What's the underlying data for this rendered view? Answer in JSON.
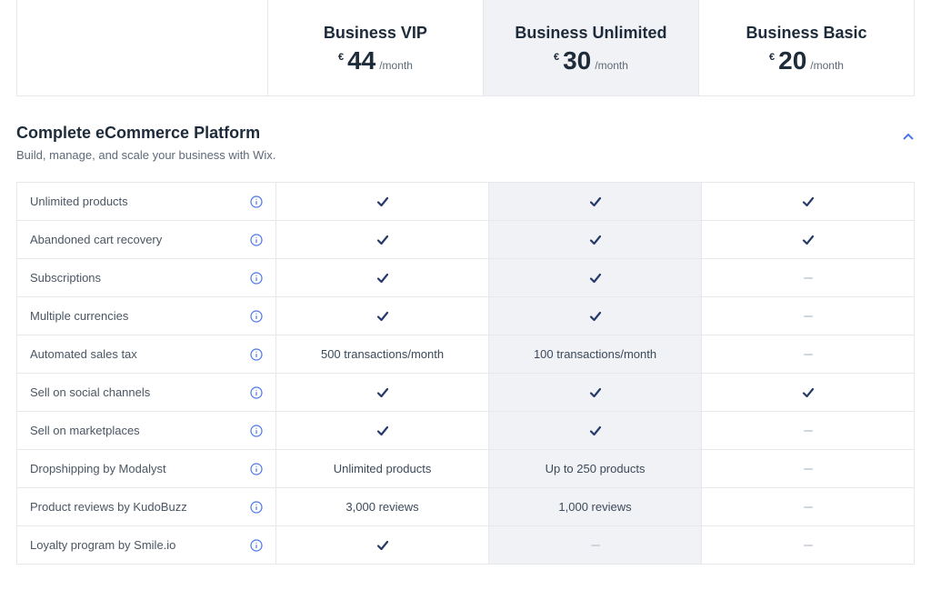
{
  "plans": [
    {
      "name": "Business VIP",
      "currency": "€",
      "price": "44",
      "period": "/month"
    },
    {
      "name": "Business Unlimited",
      "currency": "€",
      "price": "30",
      "period": "/month"
    },
    {
      "name": "Business Basic",
      "currency": "€",
      "price": "20",
      "period": "/month"
    }
  ],
  "section": {
    "title": "Complete eCommerce Platform",
    "subtitle": "Build, manage, and scale your business with Wix."
  },
  "features": [
    {
      "label": "Unlimited products",
      "values": [
        "check",
        "check",
        "check"
      ]
    },
    {
      "label": "Abandoned cart recovery",
      "values": [
        "check",
        "check",
        "check"
      ]
    },
    {
      "label": "Subscriptions",
      "values": [
        "check",
        "check",
        "dash"
      ]
    },
    {
      "label": "Multiple currencies",
      "values": [
        "check",
        "check",
        "dash"
      ]
    },
    {
      "label": "Automated sales tax",
      "values": [
        "500 transactions/month",
        "100 transactions/month",
        "dash"
      ]
    },
    {
      "label": "Sell on social channels",
      "values": [
        "check",
        "check",
        "check"
      ]
    },
    {
      "label": "Sell on marketplaces",
      "values": [
        "check",
        "check",
        "dash"
      ]
    },
    {
      "label": "Dropshipping by Modalyst",
      "values": [
        "Unlimited products",
        "Up to 250 products",
        "dash"
      ]
    },
    {
      "label": "Product reviews by KudoBuzz",
      "values": [
        "3,000 reviews",
        "1,000 reviews",
        "dash"
      ]
    },
    {
      "label": "Loyalty program by Smile.io",
      "values": [
        "check",
        "dash",
        "dash"
      ]
    }
  ]
}
